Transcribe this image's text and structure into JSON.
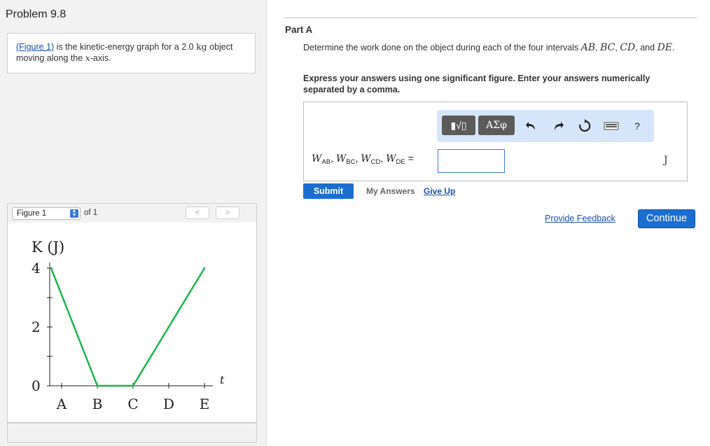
{
  "problem": {
    "title": "Problem 9.8",
    "intro_link": "(Figure 1)",
    "intro_text_1": " is the kinetic-energy graph for a 2.0 ",
    "intro_unit": "kg",
    "intro_text_2": " object moving along the ",
    "intro_var": "x",
    "intro_text_3": "-axis."
  },
  "figure_nav": {
    "selected": "Figure 1",
    "of_label": "of 1",
    "prev_label": "<",
    "next_label": ">"
  },
  "chart_data": {
    "type": "line",
    "ylabel": "K (J)",
    "xlabel": "t",
    "categories": [
      "A",
      "B",
      "C",
      "D",
      "E"
    ],
    "x": [
      0,
      1,
      2,
      3,
      4
    ],
    "values": [
      4,
      0,
      0,
      2,
      4
    ],
    "y_ticks": [
      "0",
      "2",
      "4"
    ],
    "ylim": [
      0,
      4
    ],
    "grid": false,
    "line_color": "#1db64a"
  },
  "part_a": {
    "title": "Part A",
    "question": "Determine the work done on the object during each of the four intervals ",
    "intervals": [
      "AB",
      "BC",
      "CD",
      "DE"
    ],
    "sep_comma": ", ",
    "and_text": ", and ",
    "end_period": ".",
    "instruction": "Express your answers using one significant figure. Enter your answers numerically separated by a comma.",
    "answer_label_prefix": "W",
    "answer_subs": [
      "AB",
      "BC",
      "CD",
      "DE"
    ],
    "answer_eq": " =",
    "answer_value": "",
    "unit": "J",
    "toolbar": {
      "templates_label": "▮√▯",
      "symbols_label": "ΑΣφ",
      "help_label": "?"
    },
    "submit_label": "Submit",
    "my_answers_label": "My Answers",
    "give_up_label": "Give Up"
  },
  "footer": {
    "feedback_label": "Provide Feedback",
    "continue_label": "Continue"
  },
  "colors": {
    "accent": "#1b6ecf",
    "link": "#1a4fb0",
    "toolbar_bg": "#d5e6fa",
    "chart_line": "#1db64a"
  }
}
